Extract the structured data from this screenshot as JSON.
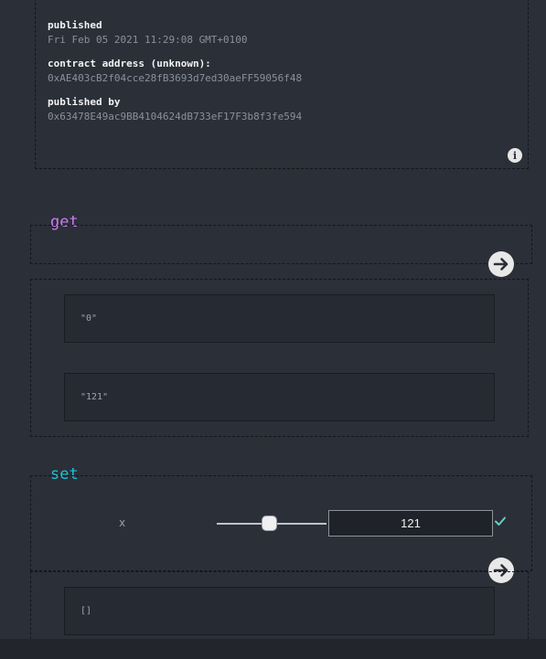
{
  "info": {
    "published_label": "published",
    "published_value": "Fri Feb 05 2021 11:29:08 GMT+0100",
    "contract_label": "contract address (unknown):",
    "contract_value": "0xAE403cB2f04cce28fB3693d7ed30aeFF59056f48",
    "published_by_label": "published by",
    "published_by_value": "0x63478E49ac9BB4104624dB733eF17F3b8f3fe594",
    "info_icon": "i"
  },
  "get_section": {
    "title": "get",
    "results": [
      "\"0\"",
      "\"121\""
    ]
  },
  "set_section": {
    "title": "set",
    "param_label": "x",
    "input_value": "121",
    "slider_level": 0.48,
    "result": "[]"
  },
  "colors": {
    "background": "#2b2f38",
    "get_title": "#cc7bf1",
    "set_title": "#19c3d6",
    "check": "#5fd1c4"
  }
}
